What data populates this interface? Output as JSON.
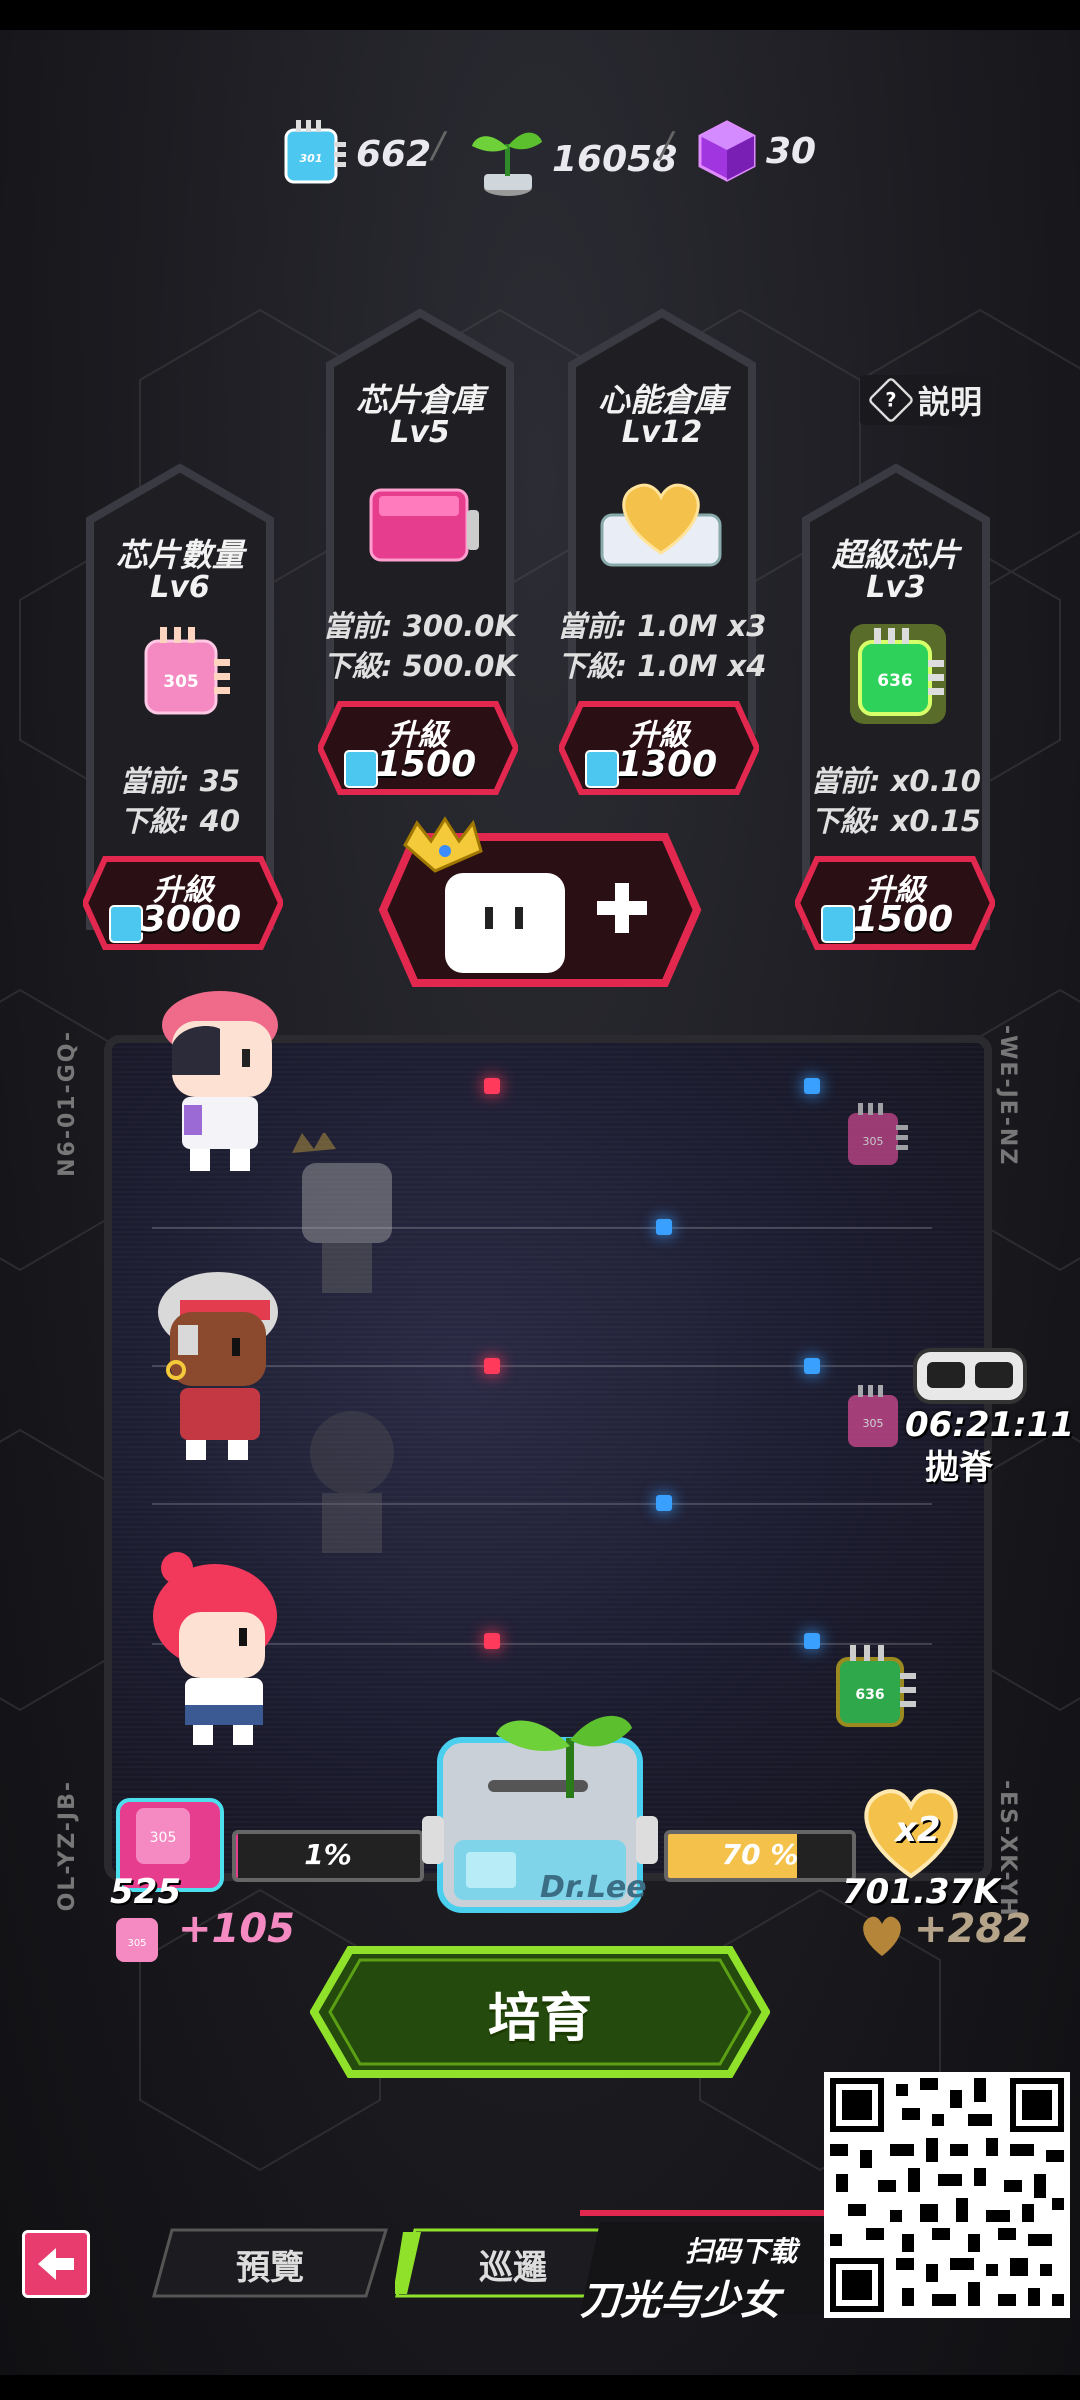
{
  "resources": {
    "chips": "662",
    "sprouts": "16058",
    "cubes": "30"
  },
  "help": {
    "label": "説明"
  },
  "cards": [
    {
      "title": "芯片數量",
      "level": "Lv6",
      "current": "當前: 35",
      "next": "下級: 40",
      "button": "升級",
      "cost": "3000",
      "chip_code": "305"
    },
    {
      "title": "芯片倉庫",
      "level": "Lv5",
      "current": "當前: 300.0K",
      "next": "下級: 500.0K",
      "button": "升級",
      "cost": "1500"
    },
    {
      "title": "心能倉庫",
      "level": "Lv12",
      "current": "當前: 1.0M x3",
      "next": "下級: 1.0M x4",
      "button": "升級",
      "cost": "1300"
    },
    {
      "title": "超級芯片",
      "level": "Lv3",
      "current": "當前: x0.10",
      "next": "下級: x0.15",
      "button": "升級",
      "cost": "1500",
      "chip_code": "636"
    }
  ],
  "arena": {
    "left_top_code": "N6-01-GQ-",
    "right_top_code": "-WE-JE-NZ",
    "left_bottom_code": "OL-YZ-JB-",
    "right_bottom_code": "-ES-XK-YH",
    "chip_small_code": "305",
    "chip_green_code": "636",
    "timer": "06:21:11",
    "timer_label": "拋脊"
  },
  "progress": {
    "chip_percent": 1,
    "chip_percent_label": "1%",
    "chip_count": "525",
    "chip_gain": "+105",
    "heart_percent": 70,
    "heart_percent_label": "70 %",
    "heart_multiplier": "x2",
    "heart_total": "701.37K",
    "heart_gain": "+282",
    "center_label": "Dr.Lee"
  },
  "actions": {
    "breed": "培育"
  },
  "nav": {
    "preview": "預覽",
    "patrol": "巡邏"
  },
  "promo": {
    "line1": "扫码下载",
    "line2": "刀光与少女"
  },
  "colors": {
    "accent_red": "#e3284f",
    "accent_green": "#8fe12a",
    "chip_blue": "#4cc7ef",
    "chip_pink": "#f58ac2",
    "heart_gold": "#f4c24b"
  }
}
